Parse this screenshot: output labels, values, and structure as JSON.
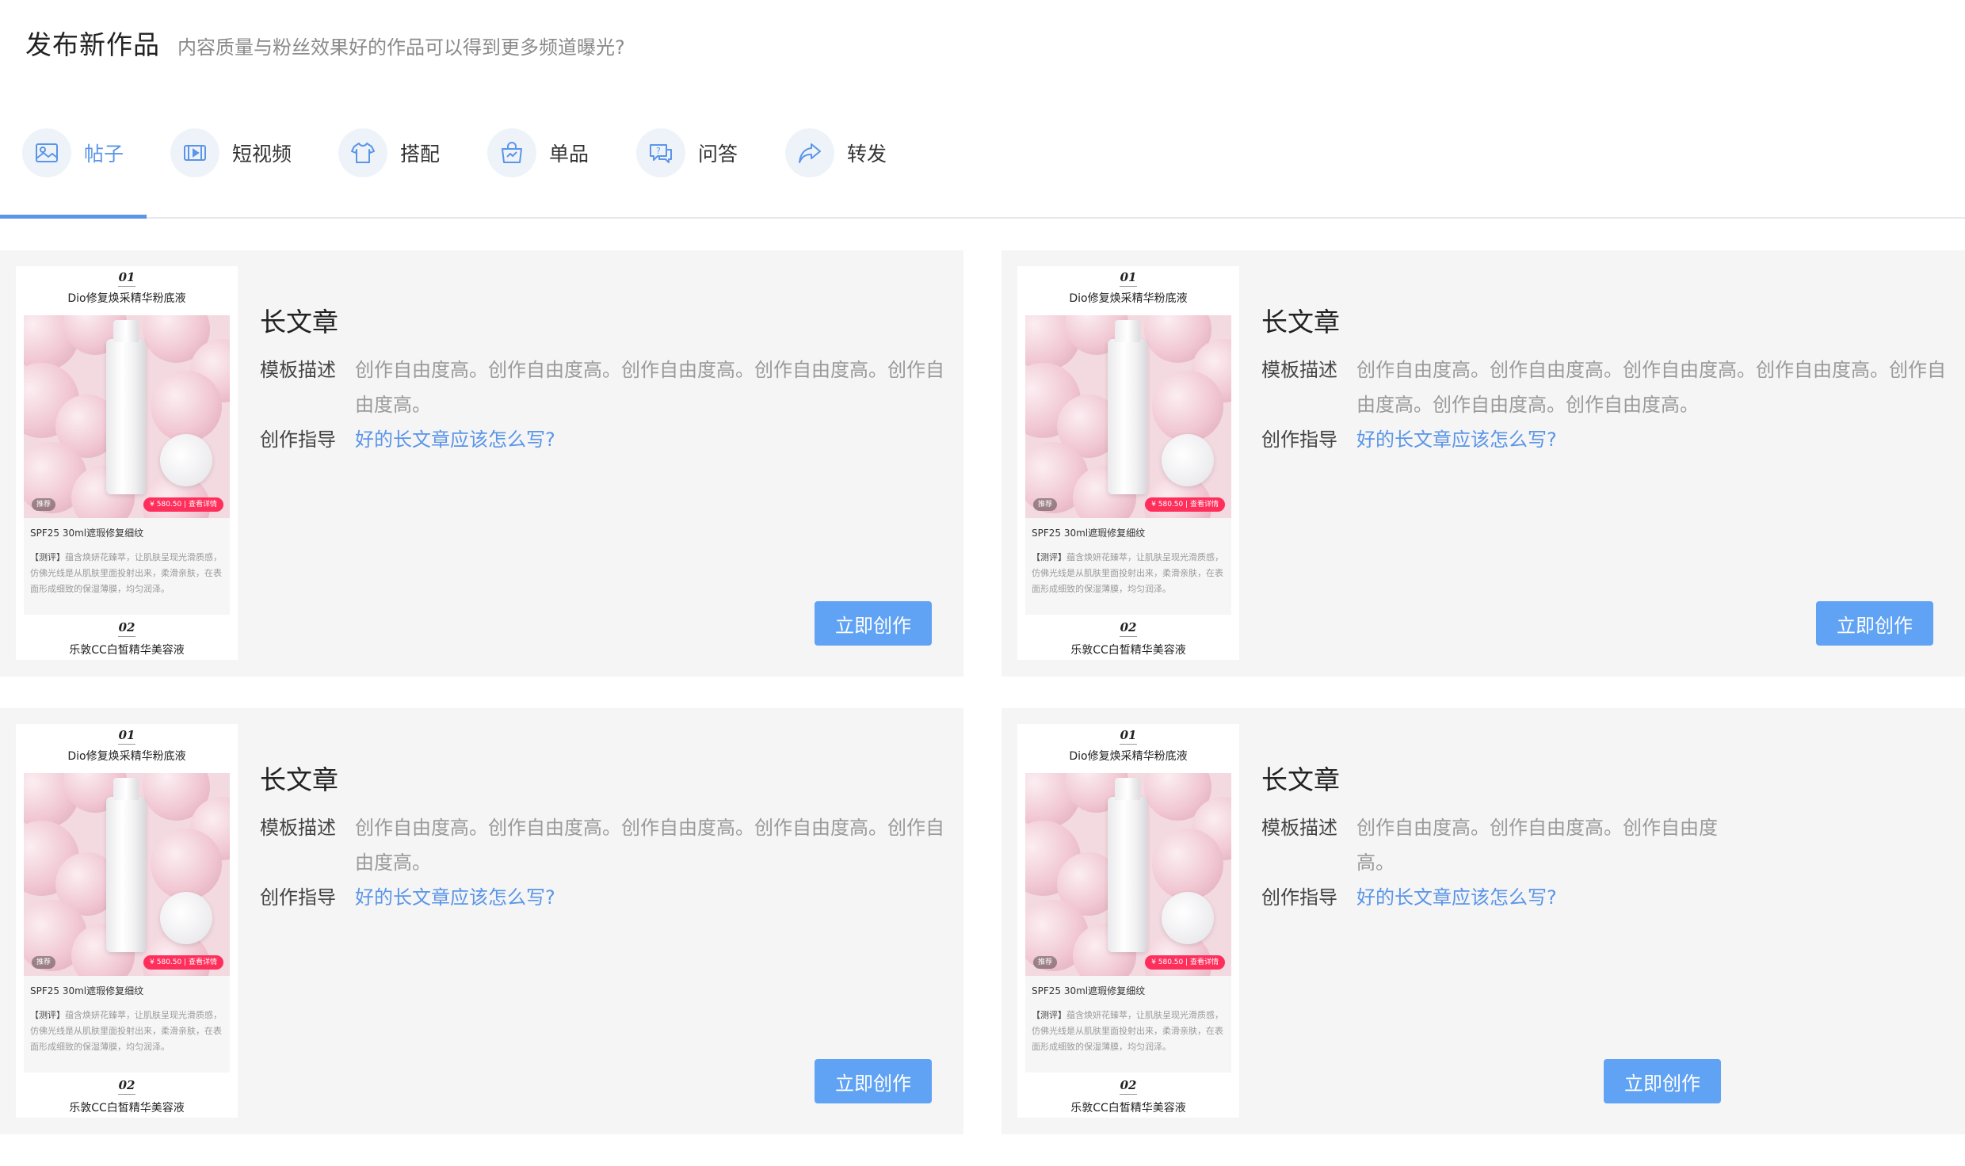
{
  "header": {
    "title": "发布新作品",
    "subtitle": "内容质量与粉丝效果好的作品可以得到更多频道曝光?"
  },
  "tabs": [
    {
      "label": "帖子",
      "icon": "image-post-icon",
      "active": true
    },
    {
      "label": "短视频",
      "icon": "video-icon",
      "active": false
    },
    {
      "label": "搭配",
      "icon": "tshirt-icon",
      "active": false
    },
    {
      "label": "单品",
      "icon": "bag-icon",
      "active": false
    },
    {
      "label": "问答",
      "icon": "qa-icon",
      "active": false
    },
    {
      "label": "转发",
      "icon": "share-icon",
      "active": false
    }
  ],
  "thumbnail": {
    "num1": "01",
    "title1": "Dio修复焕采精华粉底液",
    "price": "¥ 580.50 | 查看详情",
    "tag": "推荐",
    "product": "SPF25 30ml遮瑕修复细纹",
    "review_tag": "【测评】",
    "review": "蕴含焕妍花臻萃，让肌肤呈现光滑质感，仿佛光线是从肌肤里面投射出来，柔滑亲肤，在表面形成细致的保湿薄膜，均匀润泽。",
    "num2": "02",
    "title2": "乐敦CC白皙精华美容液"
  },
  "cards": [
    {
      "title": "长文章",
      "desc_label": "模板描述",
      "desc_line1": "创作自由度高。创作自由度高。创作自由度高。创作自由度高。创作自",
      "desc_line2": "由度高。",
      "guide_label": "创作指导",
      "guide_link": "好的长文章应该怎么写?",
      "button": "立即创作"
    },
    {
      "title": "长文章",
      "desc_label": "模板描述",
      "desc_line1": "创作自由度高。创作自由度高。创作自由度高。创作自由度高。创作自",
      "desc_line2": "由度高。创作自由度高。创作自由度高。",
      "guide_label": "创作指导",
      "guide_link": "好的长文章应该怎么写?",
      "button": "立即创作"
    },
    {
      "title": "长文章",
      "desc_label": "模板描述",
      "desc_line1": "创作自由度高。创作自由度高。创作自由度高。创作自由度高。创作自",
      "desc_line2": "由度高。",
      "guide_label": "创作指导",
      "guide_link": "好的长文章应该怎么写?",
      "button": "立即创作"
    },
    {
      "title": "长文章",
      "desc_label": "模板描述",
      "desc_line1": "创作自由度高。创作自由度高。创作自由度",
      "desc_line2": "高。",
      "guide_label": "创作指导",
      "guide_link": "好的长文章应该怎么写?",
      "button": "立即创作"
    }
  ],
  "colors": {
    "accent": "#5b95e8",
    "button": "#60a2f4",
    "card_bg": "#f5f5f5",
    "muted_text": "#9a9a9a"
  }
}
